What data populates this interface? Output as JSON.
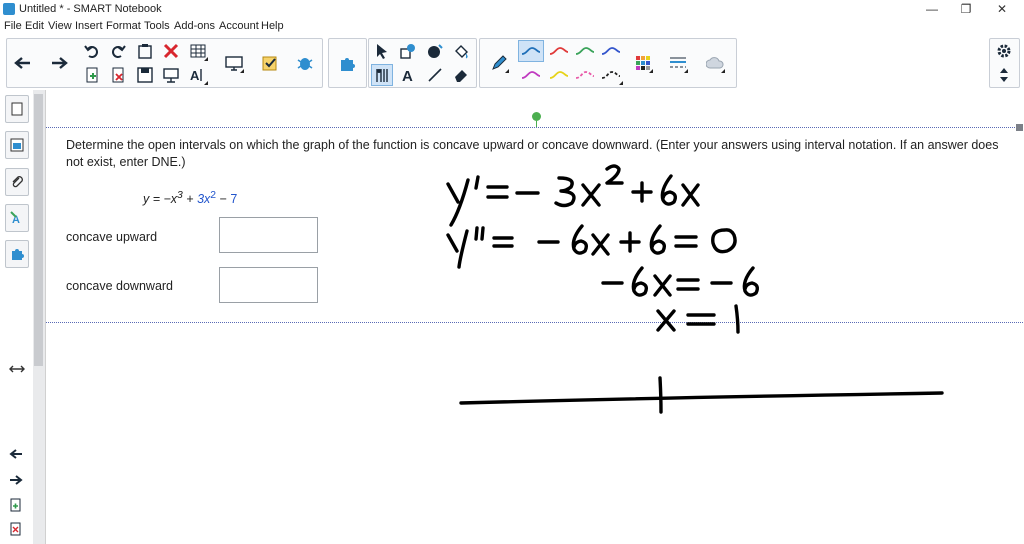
{
  "window": {
    "title": "Untitled * - SMART Notebook",
    "minimize": "—",
    "restore": "❐",
    "close": "✕"
  },
  "menu": [
    "File",
    "Edit",
    "View",
    "Insert",
    "Format",
    "Tools",
    "Add-ons",
    "Account",
    "Help"
  ],
  "toolbar": {
    "colors": {
      "pen_cyan": "#1f6fb8",
      "pen_red": "#e03a3a",
      "pen_green": "#3aa35a",
      "pen_blue": "#3355cc",
      "pen_magenta": "#c03ac0",
      "pen_yellow": "#e6d31a",
      "pen_pink": "#e85aa8",
      "pen_black": "#222222",
      "accent": "#1a73c7"
    }
  },
  "question": {
    "text": "Determine the open intervals on which the graph of the function is concave upward or concave downward. (Enter your answers using interval notation. If an answer does not exist, enter DNE.)",
    "eq_prefix": "y = −x",
    "eq_exp1": "3",
    "eq_plus": " + ",
    "eq_term2": "3x",
    "eq_exp2": "2",
    "eq_minus": " − ",
    "eq_const": "7",
    "concave_upward_label": "concave upward",
    "concave_downward_label": "concave downward",
    "concave_upward_value": "",
    "concave_downward_value": ""
  },
  "handwriting": {
    "line1": "y' = − 3x² + 6x",
    "line2": "y'' = − 6x + 6 = 0",
    "line3": "−6x = −6",
    "line4": "x = 1"
  }
}
